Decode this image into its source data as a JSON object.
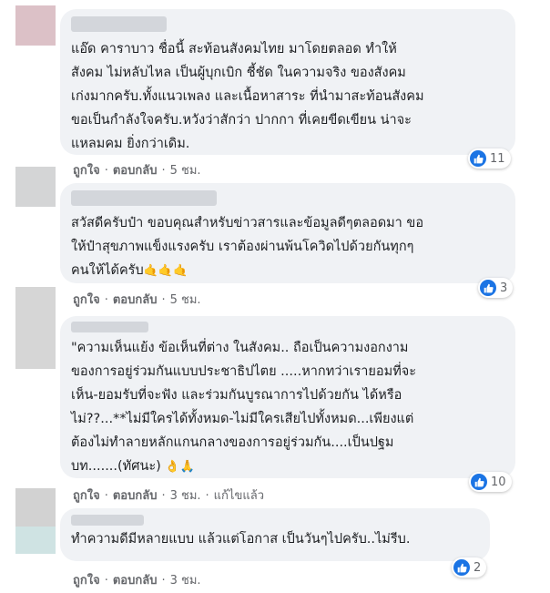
{
  "comments": [
    {
      "text": "แอ๊ด คาราบาว ชื่อนี้ สะท้อนสังคมไทย มาโดยตลอด ทำให้\nสังคม ไม่หลับไหล เป็นผู้บุกเบิก ชี้ชัด ในความจริง ของสังคม\nเก่งมากครับ.ทั้งแนวเพลง และเนื้อหาสาระ ที่นำมาสะท้อนสังคม\nขอเป็นกำลังใจครับ.หวังว่าสักว่า ปากกา ที่เคยขีดเขียน น่าจะ\nแหลมคม ยิ่งกว่าเดิม.",
      "like_label": "ถูกใจ",
      "reply_label": "ตอบกลับ",
      "time": "5 ชม.",
      "edited": "",
      "reaction_count": "11",
      "avatar_color": "#dcc1c7"
    },
    {
      "text": "สวัสดีครับป๋า ขอบคุณสำหรับข่าวสารและข้อมูลดีๆตลอดมา ขอ\nให้ป๋าสุขภาพแข็งแรงครับ เราต้องผ่านพ้นโควิดไปด้วยกันทุกๆ\nคนให้ได้ครับ",
      "emojis": "🤙🤙🤙",
      "like_label": "ถูกใจ",
      "reply_label": "ตอบกลับ",
      "time": "5 ชม.",
      "edited": "",
      "reaction_count": "3",
      "avatar_color": "#d4d5d6"
    },
    {
      "text": "\"ความเห็นแย้ง ข้อเห็นที่ต่าง ในสังคม.. ถือเป็นความงอกงาม\nของการอยู่ร่วมกันแบบประชาธิปไตย .....หากทว่าเรายอมที่จะ\nเห็น-ยอมรับที่จะฟัง และร่วมกันบูรณาการไปด้วยกัน ได้หรือ\nไม่??...**ไม่มีใครได้ทั้งหมด-ไม่มีใครเสียไปทั้งหมด...เพียงแต่\nต้องไม่ทำลายหลักแกนกลางของการอยู่ร่วมกัน....เป็นปฐม\nบท.......(ทัศนะ)",
      "emojis": "👌🙏",
      "like_label": "ถูกใจ",
      "reply_label": "ตอบกลับ",
      "time": "3 ชม.",
      "edited": "แก้ไขแล้ว",
      "reaction_count": "10",
      "avatar_color": "#d6d6d6"
    },
    {
      "text": "ทำความดีมีหลายแบบ แล้วแต่โอกาส เป็นวันๆไปครับ..ไม่รีบ.",
      "like_label": "ถูกใจ",
      "reply_label": "ตอบกลับ",
      "time": "3 ชม.",
      "edited": "",
      "reaction_count": "2",
      "avatar_color": "#d2d2d2"
    }
  ]
}
